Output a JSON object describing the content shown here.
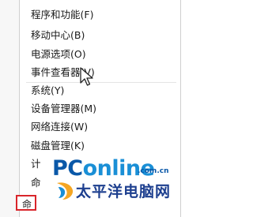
{
  "menu": {
    "items": [
      {
        "label": "程序和功能(F)"
      },
      {
        "label": "移动中心(B)"
      },
      {
        "label": "电源选项(O)"
      },
      {
        "label": "事件查看器(V)"
      },
      {
        "label": "系统(Y)"
      },
      {
        "label": "设备管理器(M)"
      },
      {
        "label": "网络连接(W)"
      },
      {
        "label": "磁盘管理(K)"
      },
      {
        "label": "计"
      },
      {
        "label": "命"
      },
      {
        "label": "命"
      }
    ]
  },
  "watermark": {
    "brand_prefix": "PC",
    "brand_suffix": "online",
    "domain": ".com.cn",
    "chinese_name": "太平洋电脑网"
  },
  "colors": {
    "highlight_box": "#d9252b",
    "logo_blue": "#0a58a8",
    "logo_light_blue": "#1a8fd6",
    "logo_orange": "#f5a623"
  },
  "icons": {
    "cursor": "mouse-pointer-icon",
    "logo_mark": "pconline-logo-icon"
  }
}
